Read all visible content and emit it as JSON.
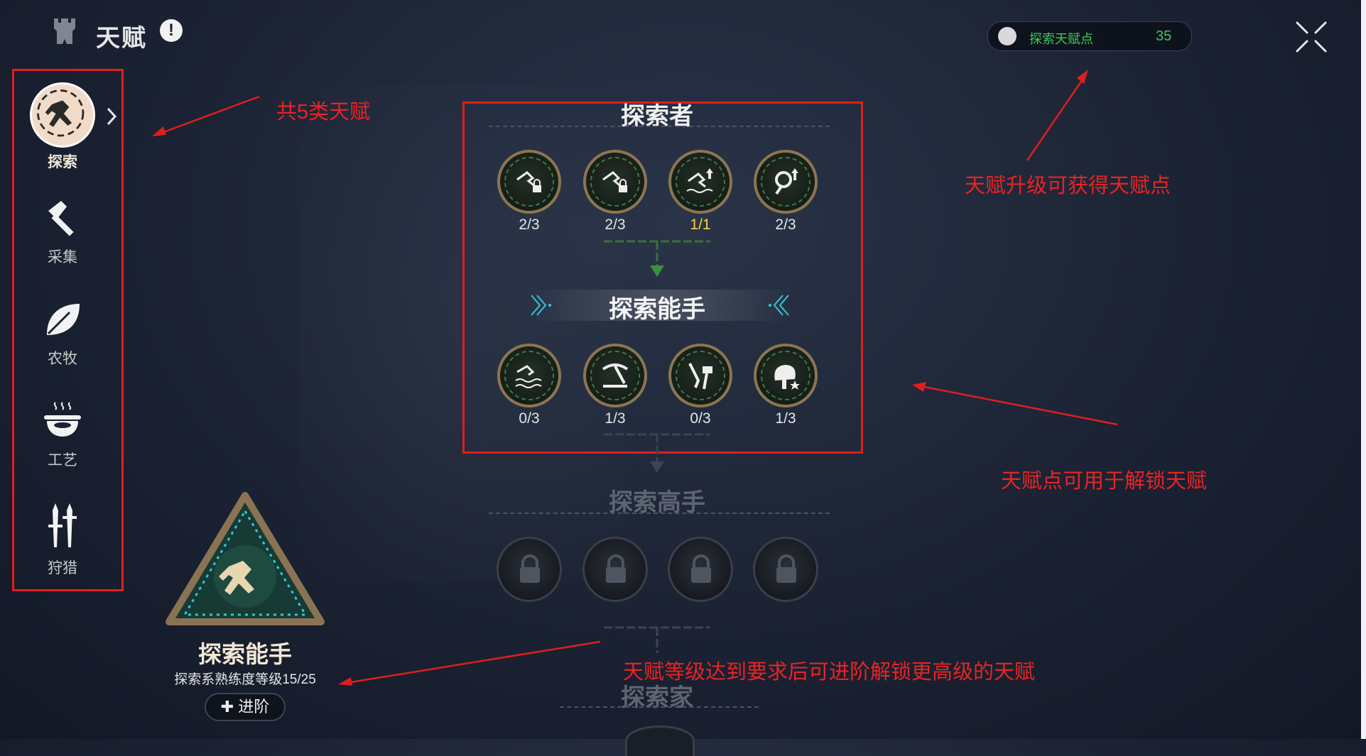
{
  "header": {
    "title": "天赋",
    "warning_glyph": "!"
  },
  "points": {
    "label": "探索天赋点",
    "value": "35",
    "color": "#3ec75b"
  },
  "sidebar": {
    "items": [
      {
        "label": "探索",
        "icon": "run-icon",
        "active": true
      },
      {
        "label": "采集",
        "icon": "axe-icon"
      },
      {
        "label": "农牧",
        "icon": "leaf-icon"
      },
      {
        "label": "工艺",
        "icon": "cooking-pot-icon"
      },
      {
        "label": "狩猎",
        "icon": "spears-icon"
      }
    ]
  },
  "tree": {
    "tiers": [
      {
        "name": "探索者",
        "nodes": [
          {
            "icon": "swim-lock-icon",
            "level": "2/3"
          },
          {
            "icon": "swim-lock-icon",
            "level": "2/3"
          },
          {
            "icon": "swim-up-icon",
            "level": "1/1"
          },
          {
            "icon": "search-up-icon",
            "level": "2/3"
          }
        ]
      },
      {
        "name": "探索能手",
        "nodes": [
          {
            "icon": "swim-wave-icon",
            "level": "0/3"
          },
          {
            "icon": "pickaxe-icon",
            "level": "1/3"
          },
          {
            "icon": "tools-icon",
            "level": "0/3"
          },
          {
            "icon": "tree-star-icon",
            "level": "1/3"
          }
        ]
      },
      {
        "name": "探索高手",
        "locked": true
      },
      {
        "name": "探索家",
        "locked": true
      }
    ]
  },
  "badge": {
    "name": "探索能手",
    "subtitle": "探索系熟练度等级15/25",
    "advance_label": "进阶"
  },
  "annotations": {
    "categories": "共5类天赋",
    "points": "天赋升级可获得天赋点",
    "unlock": "天赋点可用于解锁天赋",
    "advance": "天赋等级达到要求后可进阶解锁更高级的天赋"
  },
  "colors": {
    "annotation": "#e82424",
    "level_full": "#ffd23a",
    "accent_cyan": "#33c6d6"
  }
}
